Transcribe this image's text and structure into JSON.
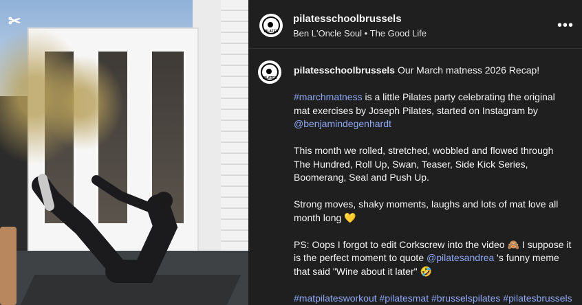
{
  "post": {
    "username": "pilatesschoolbrussels",
    "audio": {
      "artist": "Ben L'Oncle Soul",
      "separator": "•",
      "track": "The Good Life"
    },
    "more_label": "•••",
    "caption": {
      "title": "Our March matness 2026 Recap!",
      "p1": {
        "hashtag": "#marchmatness",
        "text": " is a little Pilates party celebrating the original mat exercises by Joseph Pilates, started on Instagram by ",
        "mention": "@benjamindegenhardt"
      },
      "p2": "This month we rolled, stretched, wobbled and flowed through The Hundred, Roll Up, Swan, Teaser, Side Kick Series, Boomerang, Seal and Push Up.",
      "p3": "Strong moves, shaky moments, laughs and lots of mat love all month long 💛",
      "p4": {
        "text_before": "PS: Oops I forgot to edit Corkscrew into the video 🙈 I suppose it is the perfect moment to quote ",
        "mention": "@pilatesandrea",
        "text_after": " 's funny meme that said \"Wine about it later\" 🤣"
      },
      "hashtags": [
        "#matpilatesworkout",
        "#pilatesmat",
        "#brusselspilates",
        "#pilatesbrussels"
      ]
    }
  },
  "media": {
    "icon": "capcut-icon"
  },
  "colors": {
    "panel_bg": "#1f1f1f",
    "link": "#8ea8f6",
    "text": "#f5f5f5"
  }
}
